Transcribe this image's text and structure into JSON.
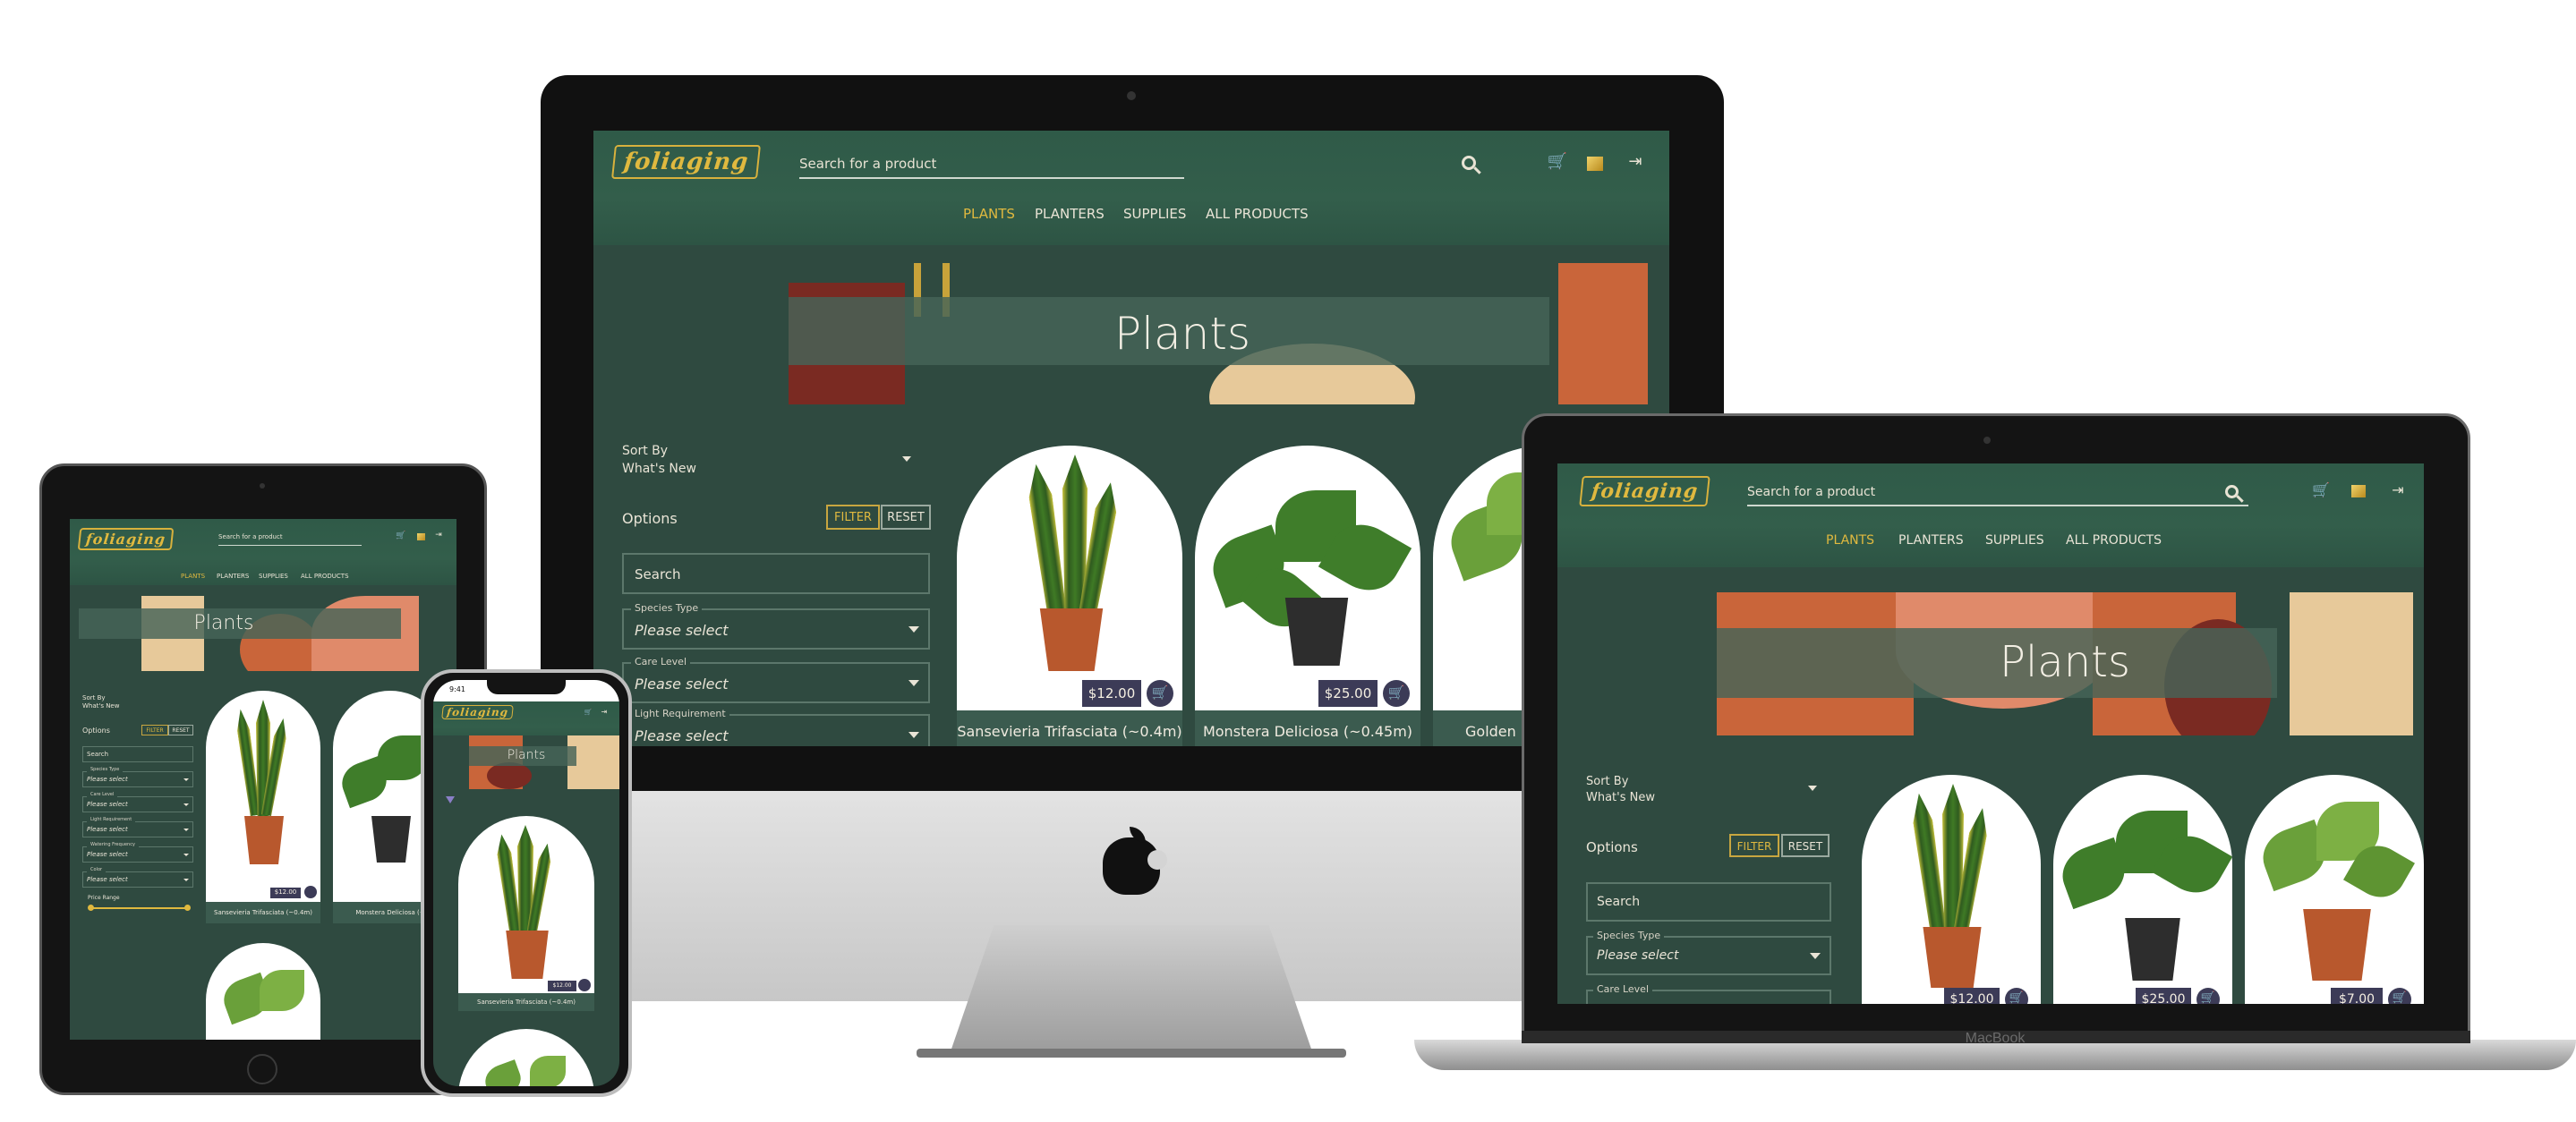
{
  "site": {
    "logo": "foliaging",
    "search_placeholder": "Search for a product",
    "search_short": "Search for a product",
    "nav": [
      "PLANTS",
      "PLANTERS",
      "SUPPLIES",
      "ALL PRODUCTS"
    ],
    "page_title": "Plants",
    "sort_by_label": "Sort By",
    "sort_by_value": "What's New",
    "options_label": "Options",
    "filter_label": "FILTER",
    "reset_label": "RESET",
    "search_field_placeholder": "Search",
    "filters": [
      {
        "label": "Species Type",
        "value": "Please select"
      },
      {
        "label": "Care Level",
        "value": "Please select"
      },
      {
        "label": "Light Requirement",
        "value": "Please select"
      },
      {
        "label": "Watering Frequency",
        "value": "Please select"
      },
      {
        "label": "Color",
        "value": "Please select"
      }
    ],
    "price_range_label": "Price Range",
    "products": [
      {
        "name": "Sansevieria Trifasciata (~0.4m)",
        "price": "$12.00"
      },
      {
        "name": "Monstera Deliciosa (~0.45m)",
        "price": "$25.00"
      },
      {
        "name": "Golden Pothos",
        "price": "$7.00"
      }
    ],
    "product_name_truncated_desktop": "Golden I",
    "product_name_tablet_1": "Sansevieria Trifasciata (~0.4m)",
    "product_name_tablet_2": "Monstera Deliciosa (~",
    "product_name_phone": "Sansevieria Trifasciata (~0.4m)"
  },
  "devices": {
    "laptop_brand": "MacBook",
    "phone_time": "9:41"
  },
  "colors": {
    "site_bg": "#2f4a40",
    "accent_gold": "#e0b93f",
    "price_tag": "#3c3b57",
    "banner_orange": "#c9653a",
    "banner_salmon": "#e08a6a",
    "banner_beige": "#e7c99a",
    "banner_maroon": "#7a2a22"
  },
  "icons": [
    "search-icon",
    "cart-icon",
    "account-icon",
    "logout-icon",
    "sort-caret-icon",
    "filter-icon",
    "apple-logo-icon"
  ]
}
